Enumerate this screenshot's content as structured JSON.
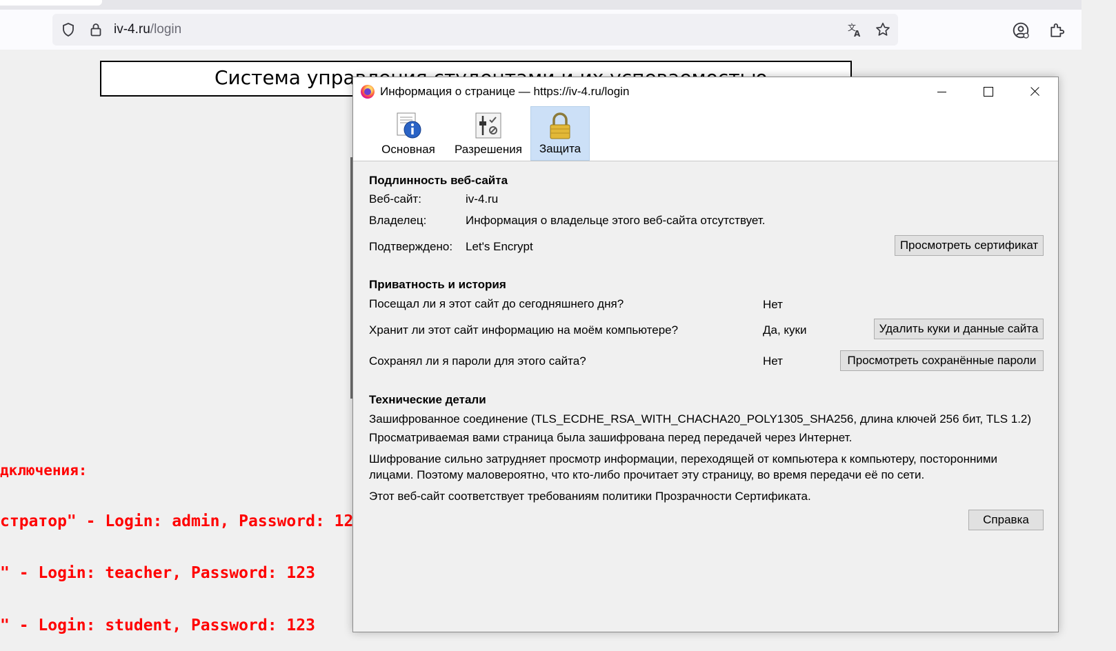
{
  "browser": {
    "url_host": "iv-4.ru",
    "url_path": "/login",
    "icons": [
      "shield-icon",
      "lock-icon",
      "translate-icon",
      "bookmark-star-icon",
      "account-icon",
      "extensions-icon"
    ]
  },
  "page": {
    "title": "Система управления студентами и их успеваемостью",
    "lines": [
      "дключения:",
      "стратор\" - Login: admin, Password: 123",
      "\" - Login: teacher, Password: 123",
      "\" - Login: student, Password: 123"
    ]
  },
  "dialog": {
    "title": "Информация о странице — https://iv-4.ru/login",
    "tabs": [
      {
        "label": "Основная",
        "icon": "info-icon"
      },
      {
        "label": "Разрешения",
        "icon": "permissions-icon"
      },
      {
        "label": "Защита",
        "icon": "padlock-icon",
        "active": true
      }
    ],
    "identity": {
      "heading": "Подлинность веб-сайта",
      "website_label": "Веб-сайт:",
      "website_value": "iv-4.ru",
      "owner_label": "Владелец:",
      "owner_value": "Информация о владельце этого веб-сайта отсутствует.",
      "verified_label": "Подтверждено:",
      "verified_value": "Let's Encrypt",
      "view_cert_button": "Просмотреть сертификат"
    },
    "privacy": {
      "heading": "Приватность и история",
      "visited_q": "Посещал ли я этот сайт до сегодняшнего дня?",
      "visited_a": "Нет",
      "stored_q": "Хранит ли этот сайт информацию на моём компьютере?",
      "stored_a": "Да, куки",
      "clear_cookies_button": "Удалить куки и данные сайта",
      "passwords_q": "Сохранял ли я пароли для этого сайта?",
      "passwords_a": "Нет",
      "view_passwords_button": "Просмотреть сохранённые пароли"
    },
    "technical": {
      "heading": "Технические детали",
      "line1": "Зашифрованное соединение (TLS_ECDHE_RSA_WITH_CHACHA20_POLY1305_SHA256, длина ключей 256 бит, TLS 1.2)",
      "line2": "Просматриваемая вами страница была зашифрована перед передачей через Интернет.",
      "line3a": "Шифрование сильно затрудняет просмотр информации, переходящей от компьютера к компьютеру, посторонними",
      "line3b": "лицами. Поэтому маловероятно, что кто-либо прочитает эту страницу, во время передачи её по сети.",
      "line4": "Этот веб-сайт соответствует требованиям политики Прозрачности Сертификата."
    },
    "help_button": "Справка"
  }
}
